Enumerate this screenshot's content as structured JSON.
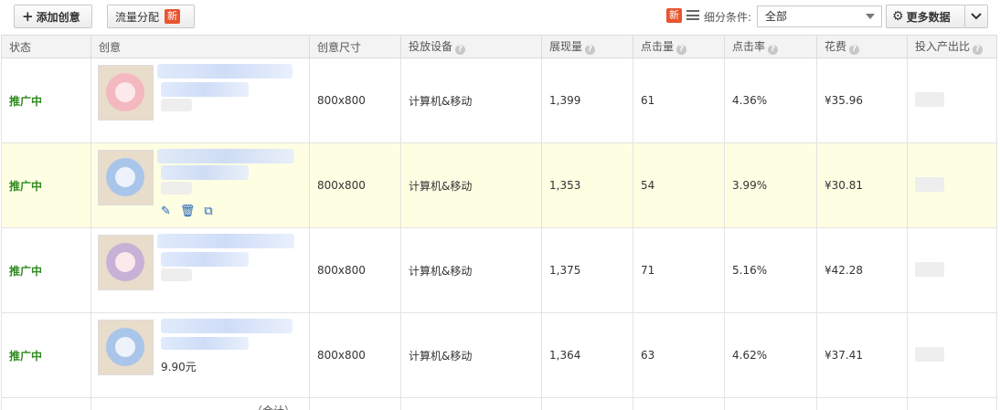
{
  "toolbar": {
    "add_label": "添加创意",
    "flow_label": "流量分配",
    "new_badge": "新",
    "filter_new_badge": "新",
    "filter_label": "细分条件:",
    "filter_value": "全部",
    "more_label": "更多数据"
  },
  "table": {
    "headers": {
      "status": "状态",
      "creative": "创意",
      "size": "创意尺寸",
      "device": "投放设备",
      "impressions": "展现量",
      "clicks": "点击量",
      "ctr": "点击率",
      "cost": "花费",
      "roi": "投入产出比"
    },
    "rows": [
      {
        "status": "推广中",
        "price": "",
        "size": "800x800",
        "device": "计算机&移动",
        "impressions": "1,399",
        "clicks": "61",
        "ctr": "4.36%",
        "cost": "¥35.96"
      },
      {
        "status": "推广中",
        "price": "",
        "size": "800x800",
        "device": "计算机&移动",
        "impressions": "1,353",
        "clicks": "54",
        "ctr": "3.99%",
        "cost": "¥30.81"
      },
      {
        "status": "推广中",
        "price": "",
        "size": "800x800",
        "device": "计算机&移动",
        "impressions": "1,375",
        "clicks": "71",
        "ctr": "5.16%",
        "cost": "¥42.28"
      },
      {
        "status": "推广中",
        "price": "9.90元",
        "size": "800x800",
        "device": "计算机&移动",
        "impressions": "1,364",
        "clicks": "63",
        "ctr": "4.62%",
        "cost": "¥37.41"
      }
    ],
    "total_label": "（合计）"
  },
  "colors": {
    "status_green": "#2e8b1e",
    "highlight_row": "#fefee3",
    "badge_red": "#e8542f",
    "action_blue": "#1f5fb5"
  },
  "icons": {
    "add": "plus-icon",
    "more": "gear-icon",
    "edit": "pencil-icon",
    "delete": "trash-icon",
    "copy": "copy-icon"
  }
}
